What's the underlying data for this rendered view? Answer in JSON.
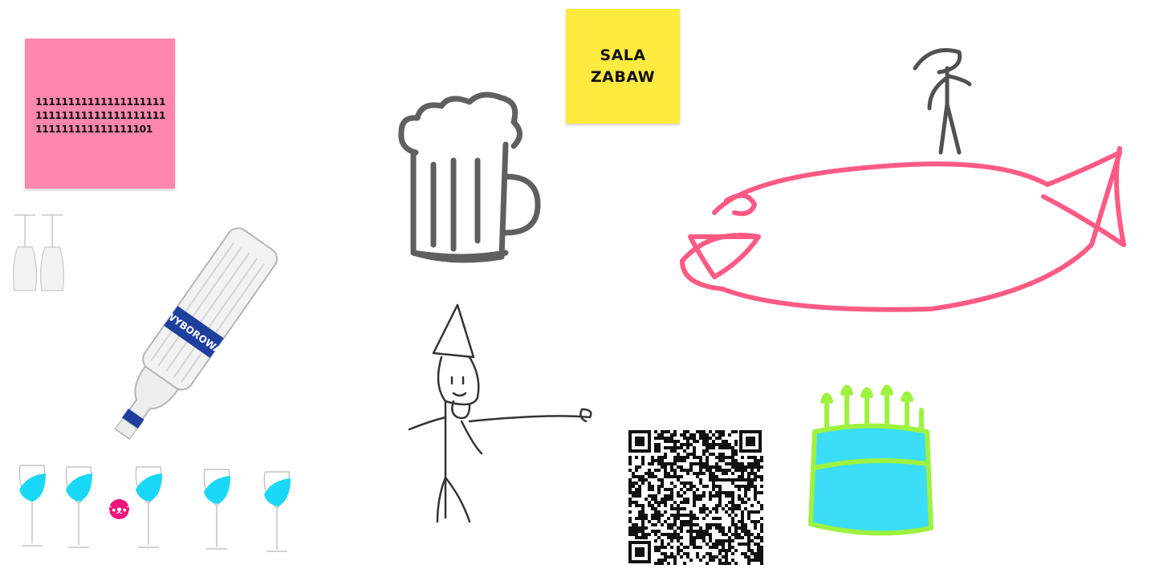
{
  "board": {
    "colors": {
      "pink_note": "#ff86ad",
      "yellow_note": "#ffea3f",
      "fish_stroke": "#ff3e6e",
      "cake_fill": "#19d8f7",
      "cake_stroke": "#8cf01e",
      "ink": "#3b3b3b",
      "badge": "#f0137a",
      "bottle_label": "#1f3f9e"
    }
  },
  "notes": {
    "pink": {
      "text": "1111111111111111111111111111111111111111111111111111111101"
    },
    "yellow": {
      "text": "SALA\nZABAW"
    }
  },
  "bottle": {
    "label_text": "WYBOROWA"
  },
  "badge": {
    "icon": "bear-icon"
  },
  "drawings": [
    "beer-mug",
    "stick-figure-small",
    "fish",
    "wizard-figure",
    "qr-code",
    "birthday-cake",
    "wine-glasses"
  ]
}
